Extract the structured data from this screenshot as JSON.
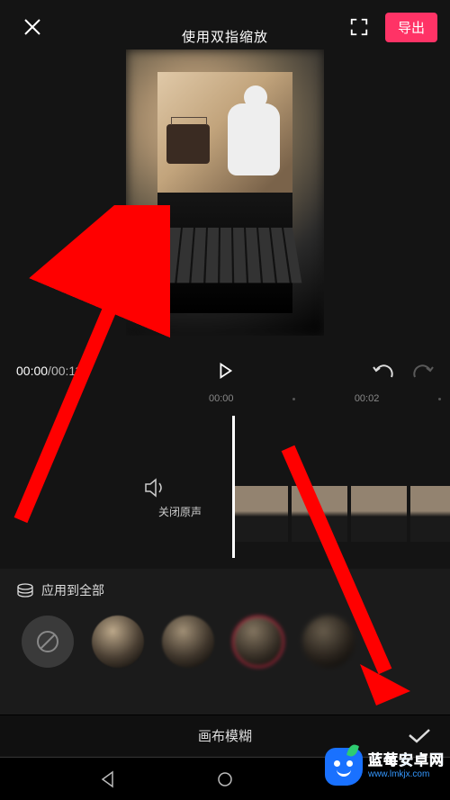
{
  "header": {
    "pinch_hint": "使用双指缩放",
    "export_label": "导出"
  },
  "playback": {
    "current_time": "00:00",
    "total_time": "00:11"
  },
  "ruler": {
    "marks": [
      "00:00",
      "00:02"
    ]
  },
  "timeline": {
    "mute_label": "关闭原声"
  },
  "blur_panel": {
    "apply_all_label": "应用到全部",
    "title": "画布模糊",
    "selected_index": 3
  },
  "watermark": {
    "title": "蓝莓安卓网",
    "url": "www.lmkjx.com"
  }
}
